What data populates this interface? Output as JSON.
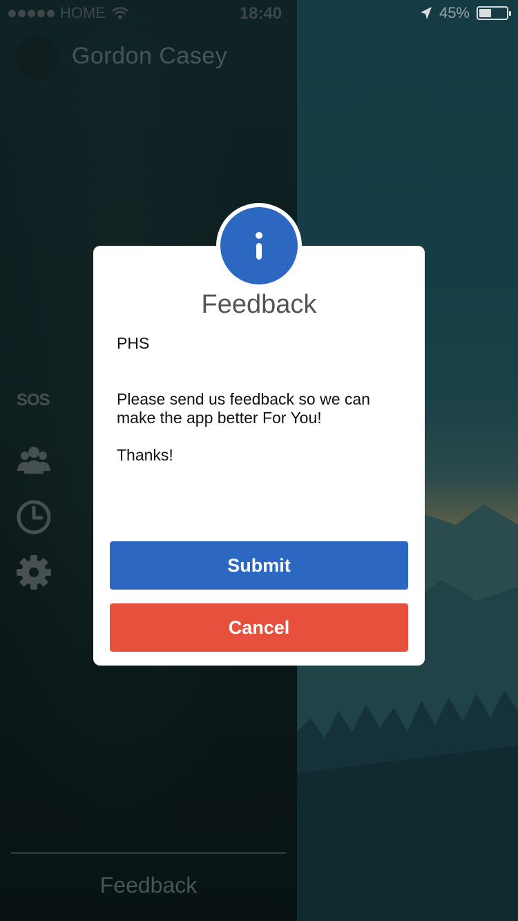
{
  "status_bar": {
    "carrier": "HOME",
    "time": "18:40",
    "battery_percent": "45%",
    "battery_level": 0.45
  },
  "drawer": {
    "user_name": "Gordon Casey",
    "menu": {
      "sos_label": "SOS",
      "items": [
        "people-icon",
        "clock-icon",
        "gear-icon"
      ]
    },
    "footer_label": "Feedback"
  },
  "dialog": {
    "icon": "info-icon",
    "title": "Feedback",
    "body": "PHS\n\n\nPlease send us feedback so we can make the app better For You!\n\nThanks!",
    "submit_label": "Submit",
    "cancel_label": "Cancel"
  },
  "colors": {
    "primary": "#2c67c1",
    "danger": "#e6503c"
  }
}
